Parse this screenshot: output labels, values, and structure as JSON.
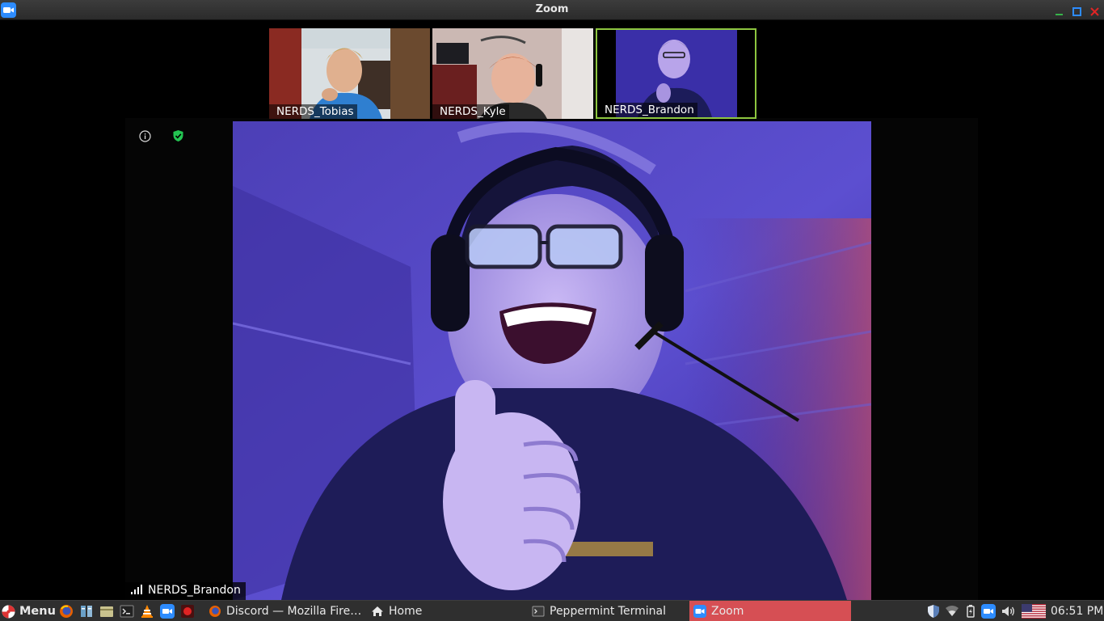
{
  "window": {
    "title": "Zoom",
    "app_icon": "zoom-camera-icon"
  },
  "thumbnails": [
    {
      "name": "NERDS_Tobias",
      "active": false
    },
    {
      "name": "NERDS_Kyle",
      "active": false
    },
    {
      "name": "NERDS_Brandon",
      "active": true
    }
  ],
  "meeting": {
    "info_icon": "info-icon",
    "security_icon": "shield-check-icon",
    "active_speaker": "NERDS_Brandon",
    "signal_icon": "signal-bars-icon"
  },
  "taskbar": {
    "menu_label": "Menu",
    "launchers": [
      "firefox-icon",
      "file-manager-icon",
      "files-icon",
      "terminal-icon",
      "vlc-icon",
      "zoom-icon",
      "screen-recorder-icon"
    ],
    "tasks": [
      {
        "label": "Discord — Mozilla Fire…",
        "icon": "firefox-icon",
        "active": false
      },
      {
        "label": "Home",
        "icon": "home-icon",
        "active": false
      },
      {
        "label": "Peppermint Terminal",
        "icon": "terminal-icon",
        "active": false
      },
      {
        "label": "Zoom",
        "icon": "zoom-icon",
        "active": true
      }
    ],
    "tray": [
      "shield-icon",
      "wifi-icon",
      "battery-icon",
      "zoom-tray-icon",
      "volume-icon",
      "us-flag-icon"
    ],
    "clock": "06:51 PM"
  },
  "colors": {
    "active_border": "#8dc63f",
    "active_task": "#d64f54",
    "zoom_blue": "#2d8cff",
    "security_green": "#23c552"
  }
}
